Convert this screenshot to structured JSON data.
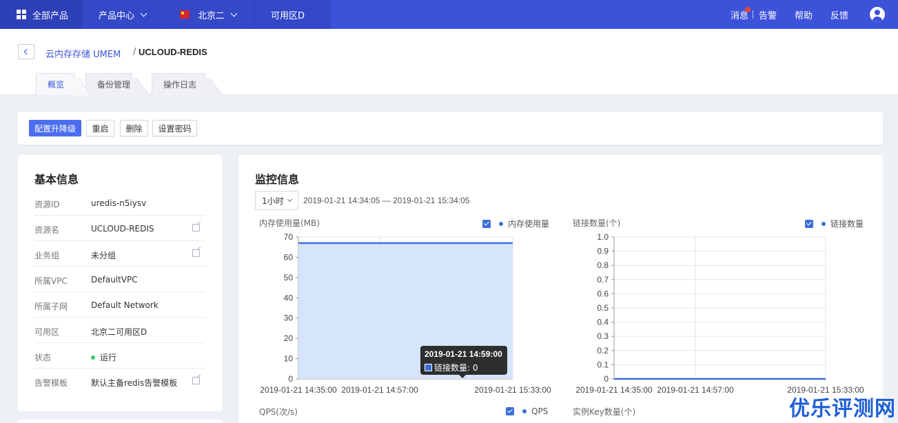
{
  "topnav": {
    "all_products": "全部产品",
    "product_center": "产品中心",
    "region": "北京二",
    "zone": "可用区D",
    "messages": "消息",
    "alarm": "告警",
    "help": "帮助",
    "feedback": "反馈"
  },
  "breadcrumb": {
    "parent": "云内存存储 UMEM",
    "separator": "/",
    "current": "UCLOUD-REDIS"
  },
  "tabs": [
    {
      "label": "概览",
      "active": true
    },
    {
      "label": "备份管理",
      "active": false
    },
    {
      "label": "操作日志",
      "active": false
    }
  ],
  "toolbar": {
    "upgrade": "配置升降级",
    "restart": "重启",
    "delete": "删除",
    "set_password": "设置密码"
  },
  "basic_info": {
    "title": "基本信息",
    "rows": [
      {
        "label": "资源ID",
        "value": "uredis-n5iysv",
        "editable": false
      },
      {
        "label": "资源名",
        "value": "UCLOUD-REDIS",
        "editable": true
      },
      {
        "label": "业务组",
        "value": "未分组",
        "editable": true
      },
      {
        "label": "所属VPC",
        "value": "DefaultVPC",
        "editable": false
      },
      {
        "label": "所属子网",
        "value": "Default Network",
        "editable": false
      },
      {
        "label": "可用区",
        "value": "北京二可用区D",
        "editable": false
      },
      {
        "label": "状态",
        "value": "运行",
        "editable": false
      },
      {
        "label": "告警模板",
        "value": "默认主备redis告警模板",
        "editable": true
      }
    ]
  },
  "monitor": {
    "title": "监控信息",
    "range": "1小时",
    "time_range": "2019-01-21 14:34:05 — 2019-01-21 15:34:05",
    "tooltip": {
      "time": "2019-01-21 14:59:00",
      "label": "链接数量: 0"
    },
    "next_row": {
      "qps_title": "QPS(次/s)",
      "qps_legend": "QPS",
      "keys_title": "实例Key数量(个)"
    }
  },
  "watermark": "优乐评测网",
  "colors": {
    "nav_bg": "#3c52d9",
    "primary": "#4b6df0",
    "series": "#3c6fd8",
    "area_fill": "#d4e4f9"
  },
  "chart_data": [
    {
      "type": "area",
      "title": "内存使用量(MB)",
      "series": [
        {
          "name": "内存使用量",
          "values": [
            67,
            67
          ]
        }
      ],
      "x": [
        "2019-01-21 14:35:00",
        "2019-01-21 15:33:00"
      ],
      "xticks": [
        "2019-01-21 14:35:00",
        "2019-01-21 14:57:00",
        "2019-01-21 15:33:00"
      ],
      "ylim": [
        0,
        70
      ],
      "yticks": [
        0,
        10,
        20,
        30,
        40,
        50,
        60,
        70
      ],
      "grid": true,
      "legend": "top-right"
    },
    {
      "type": "line",
      "title": "链接数量(个)",
      "series": [
        {
          "name": "链接数量",
          "values": [
            0,
            0
          ]
        }
      ],
      "x": [
        "2019-01-21 14:35:00",
        "2019-01-21 15:33:00"
      ],
      "xticks": [
        "2019-01-21 14:35:00",
        "2019-01-21 14:57:00",
        "2019-01-21 15:33:00"
      ],
      "ylim": [
        0,
        1.0
      ],
      "yticks": [
        "0",
        "0.1",
        "0.2",
        "0.3",
        "0.4",
        "0.5",
        "0.6",
        "0.7",
        "0.8",
        "0.9",
        "1.0"
      ],
      "grid": true,
      "legend": "top-right"
    }
  ]
}
